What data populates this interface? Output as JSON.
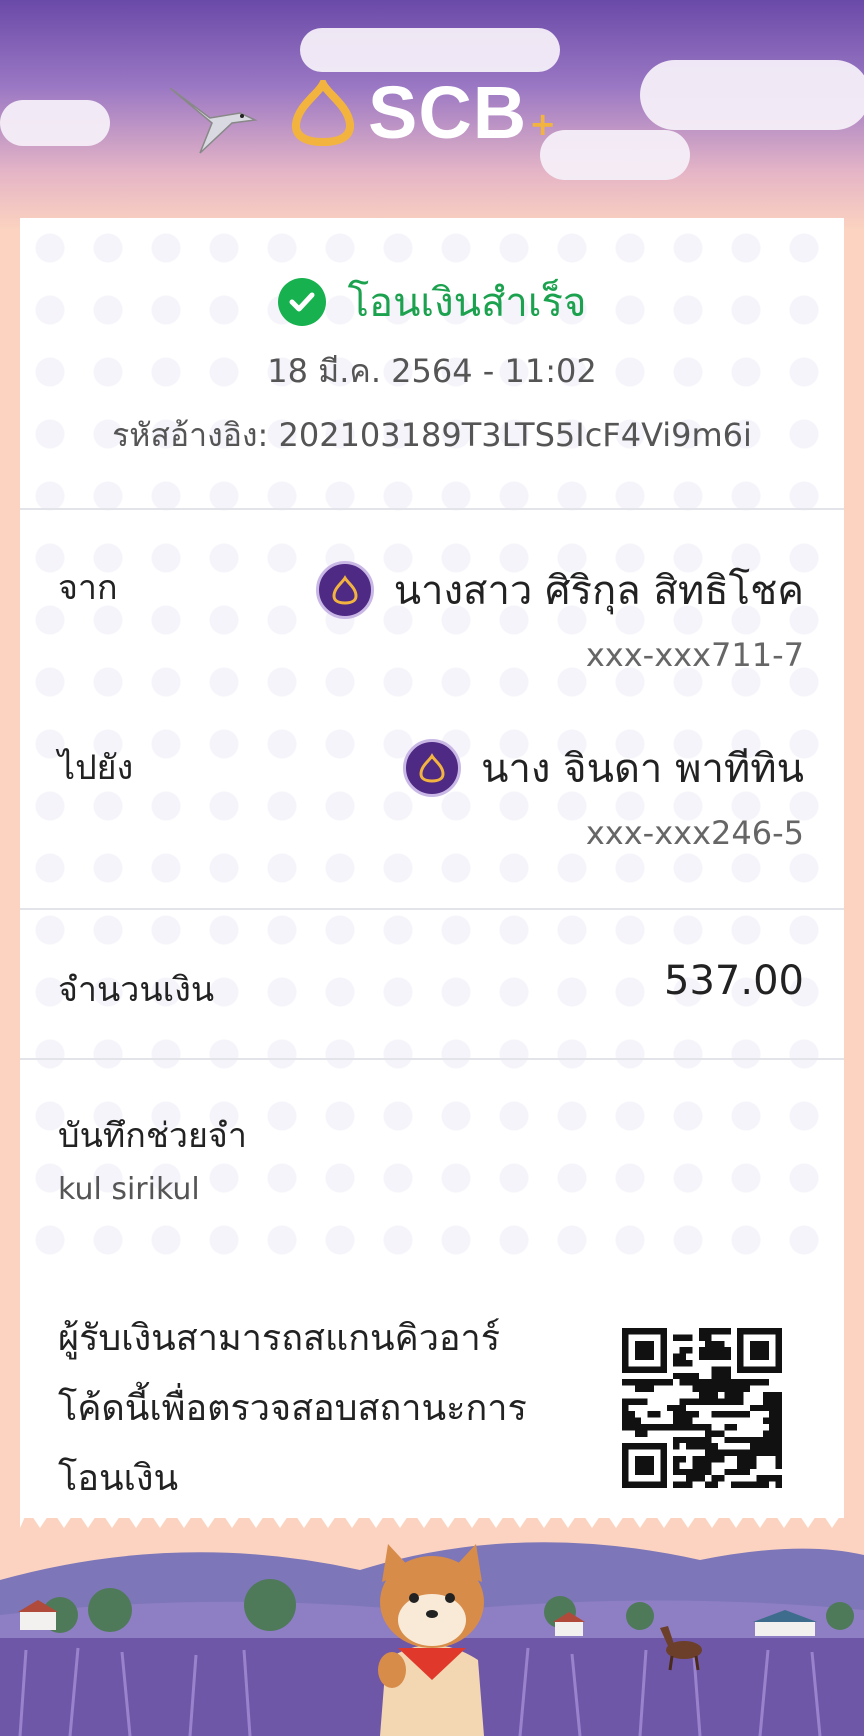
{
  "brand": {
    "name": "SCB",
    "plus": "+",
    "accent": "#f3b43f",
    "purple": "#4e2a84"
  },
  "receipt": {
    "status": "โอนเงินสำเร็จ",
    "status_color": "#1ca24e",
    "datetime": "18 มี.ค. 2564 - 11:02",
    "reference": "รหัสอ้างอิง: 202103189T3LTS5IcF4Vi9m6i",
    "from": {
      "label": "จาก",
      "name": "นางสาว ศิริกุล สิทธิโชค",
      "account": "xxx-xxx711-7"
    },
    "to": {
      "label": "ไปยัง",
      "name": "นาง จินดา พาทีทิน",
      "account": "xxx-xxx246-5"
    },
    "amount": {
      "label": "จำนวนเงิน",
      "value": "537.00"
    },
    "memo": {
      "label": "บันทึกช่วยจำ",
      "value": "kul sirikul"
    },
    "qr": {
      "line1": "ผู้รับเงินสามารถสแกนคิวอาร์",
      "line2": "โค้ดนี้เพื่อตรวจสอบสถานะการ",
      "line3": "โอนเงิน"
    }
  },
  "icons": [
    "bird-icon",
    "check-icon",
    "bank-icon",
    "qr-code",
    "shiba-dog-illustration"
  ]
}
